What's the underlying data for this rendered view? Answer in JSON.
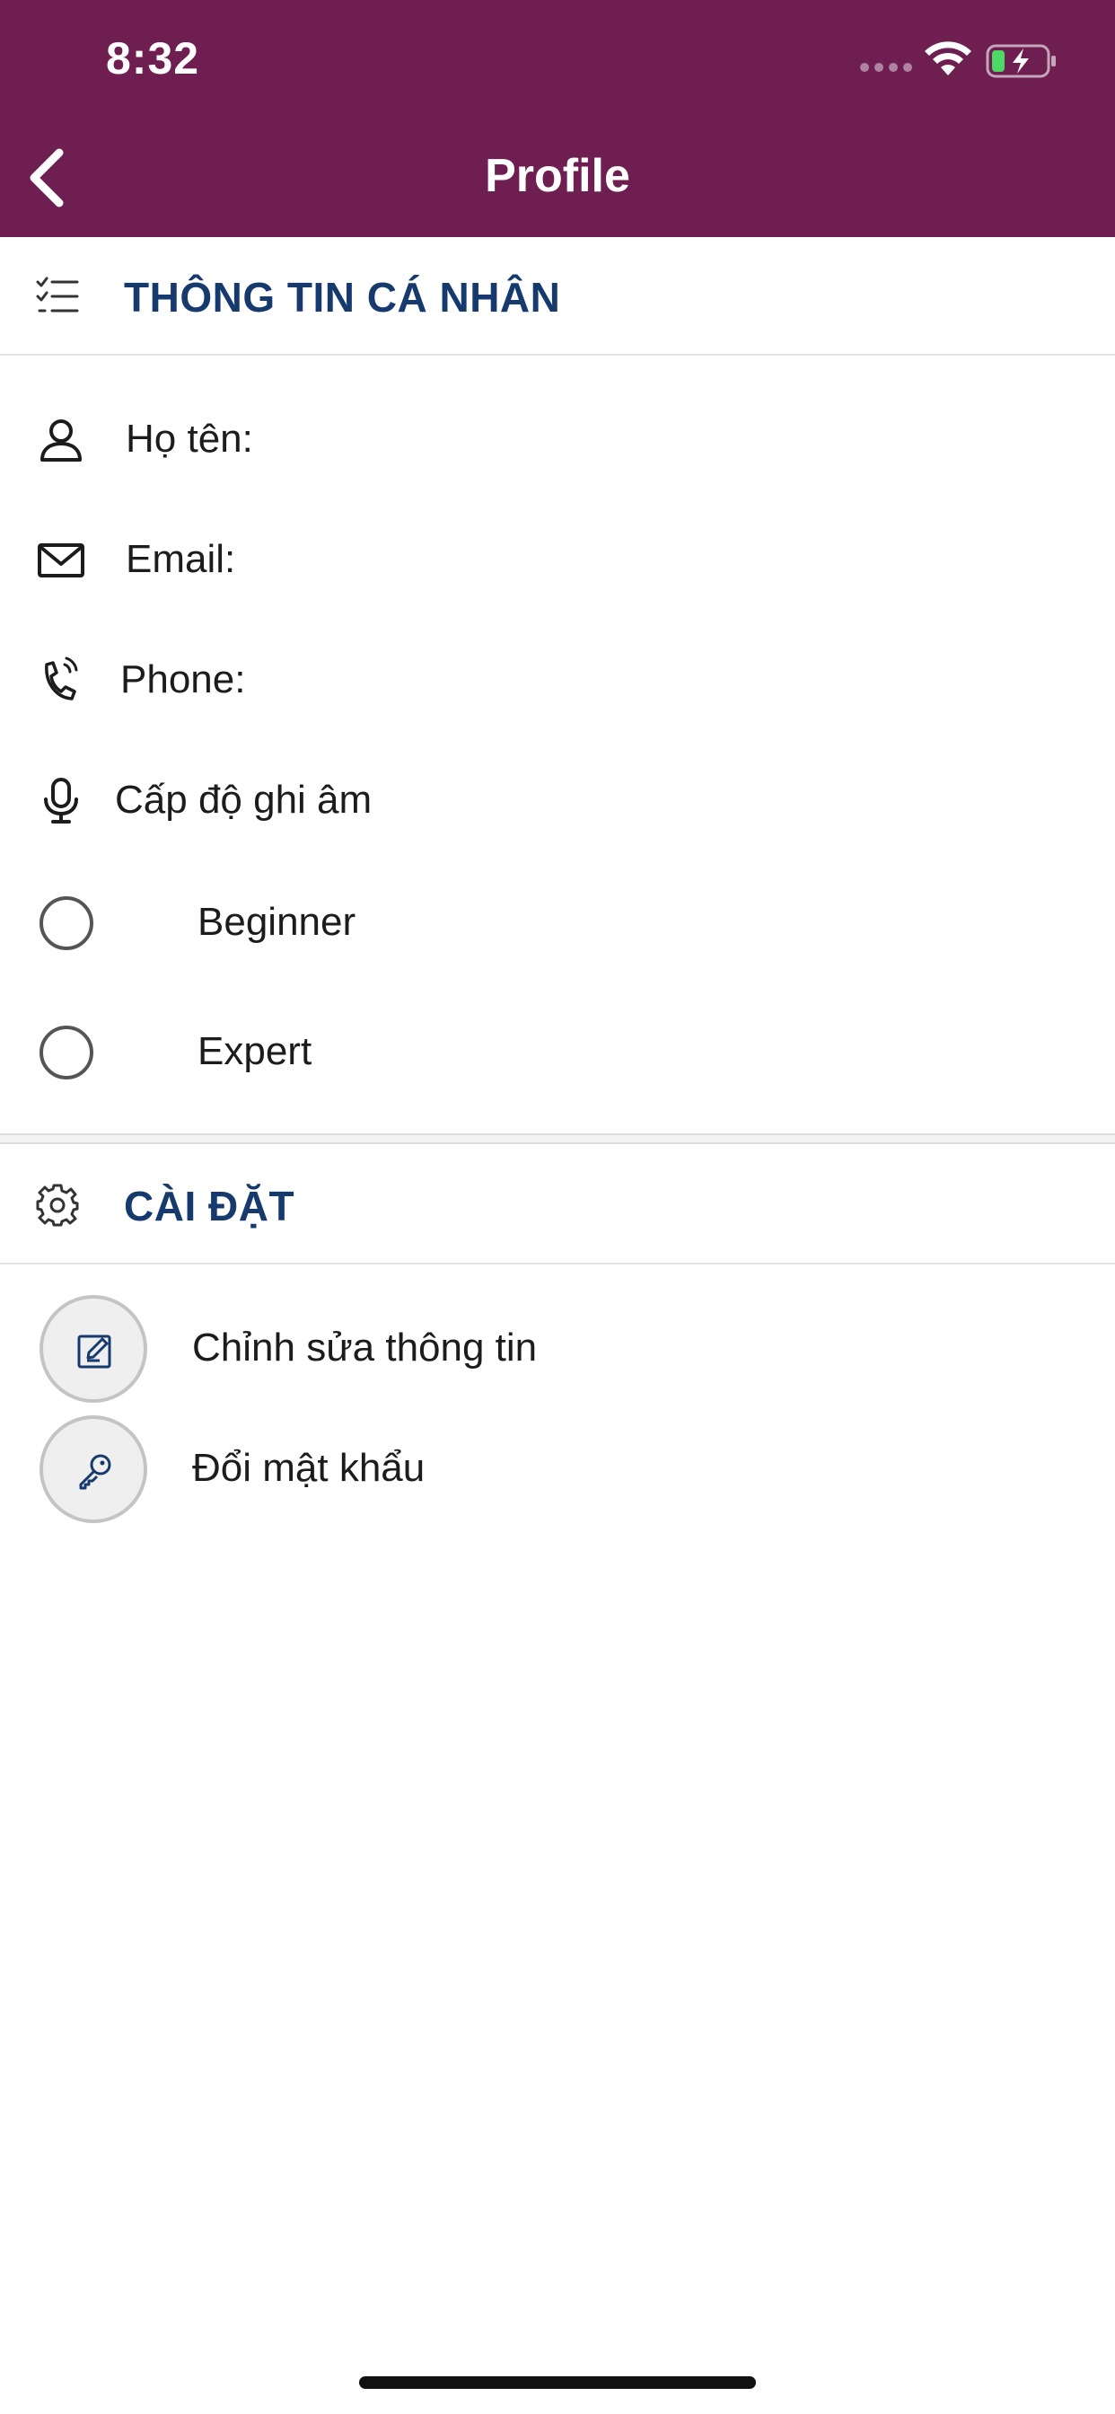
{
  "status_bar": {
    "time": "8:32"
  },
  "header": {
    "title": "Profile",
    "background_color": "#6e1e50"
  },
  "personal_section": {
    "title": "THÔNG TIN CÁ NHÂN",
    "icon": "checklist-icon",
    "fields": {
      "name_label": "Họ tên:",
      "email_label": "Email:",
      "phone_label": "Phone:",
      "recording_level_label": "Cấp độ ghi âm"
    },
    "recording_options": [
      {
        "label": "Beginner",
        "selected": false
      },
      {
        "label": "Expert",
        "selected": false
      }
    ]
  },
  "settings_section": {
    "title": "CÀI ĐẶT",
    "icon": "gear-icon",
    "items": [
      {
        "label": "Chỉnh sửa thông tin",
        "icon": "edit-icon"
      },
      {
        "label": "Đổi mật khẩu",
        "icon": "key-icon"
      }
    ]
  },
  "colors": {
    "section_title": "#173a6e",
    "header_bg": "#6e1e50"
  }
}
